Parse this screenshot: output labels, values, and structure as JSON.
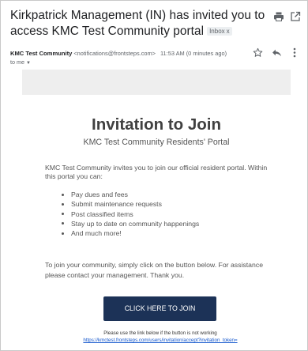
{
  "email": {
    "subject": "Kirkpatrick Management (IN) has invited you to access KMC Test Community portal",
    "label_chip": "Inbox",
    "label_chip_close": "x",
    "sender": {
      "name": "KMC Test Community",
      "email": "<notifications@frontsteps.com>",
      "time": "11:53 AM (0 minutes ago)",
      "recipient": "to me"
    }
  },
  "body": {
    "title": "Invitation to Join",
    "subtitle": "KMC Test Community Residents' Portal",
    "intro": "KMC Test Community invites you to join our official resident portal. Within this portal you can:",
    "features": [
      "Pay dues and fees",
      "Submit maintenance requests",
      "Post classified items",
      "Stay up to date on community happenings",
      "And much more!"
    ],
    "join_text": "To join your community, simply click on the button below. For assistance please contact your management. Thank you.",
    "join_button": "CLICK HERE TO JOIN",
    "fallback_note": "Please use the link below if the button is not working",
    "fallback_link": "https://kmctest.frontsteps.com/users/invitation/accept?invitation_token="
  },
  "colors": {
    "button_bg": "#1c3257",
    "banner_bg": "#eeeeee",
    "link": "#1155cc"
  },
  "icons": [
    "print-icon",
    "open-in-new-window-icon",
    "star-icon",
    "reply-icon",
    "more-vert-icon",
    "chevron-down-icon"
  ]
}
